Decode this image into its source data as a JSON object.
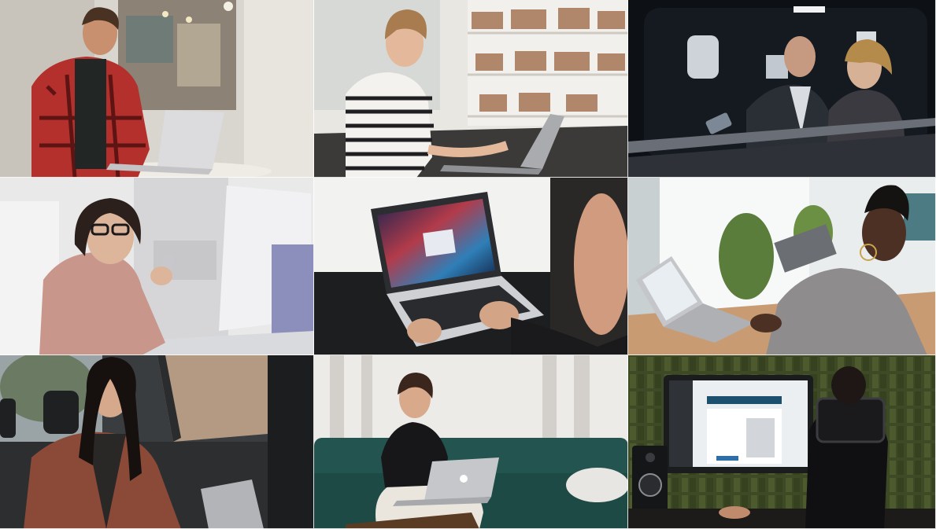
{
  "collage": {
    "layout": "3x3 photo grid",
    "tiles": [
      {
        "subject": "man-in-red-plaid-shirt-with-laptop-in-cafe"
      },
      {
        "subject": "woman-in-striped-sweater-typing-on-laptop-in-library"
      },
      {
        "subject": "man-and-woman-with-phone-in-car-at-night"
      },
      {
        "subject": "woman-with-glasses-using-phone-at-desktop-computer"
      },
      {
        "subject": "hands-typing-on-laptop-with-login-screen"
      },
      {
        "subject": "woman-using-phone-beside-laptop-at-desk"
      },
      {
        "subject": "woman-in-brown-leather-jacket-in-car-back-seat"
      },
      {
        "subject": "woman-on-teal-sofa-with-laptop"
      },
      {
        "subject": "person-at-desktop-monitor-in-studio-with-speakers"
      }
    ]
  }
}
